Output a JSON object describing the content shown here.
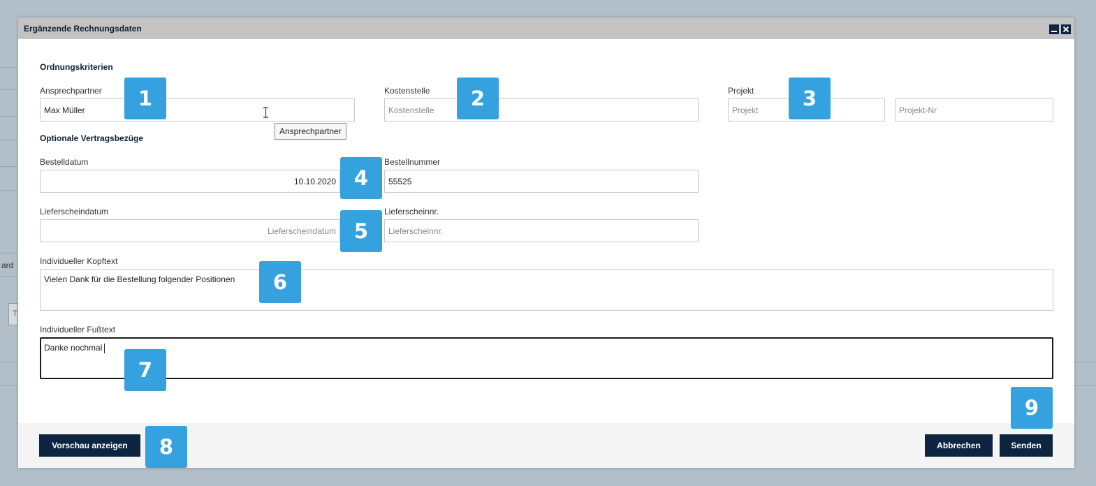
{
  "dialog": {
    "title": "Ergänzende Rechnungsdaten",
    "minimize_icon": "minimize-icon",
    "close_icon": "close-icon"
  },
  "background": {
    "fragment_text": "ard",
    "fragment_box_text": "T"
  },
  "ordering": {
    "heading": "Ordnungskriterien",
    "contact": {
      "label": "Ansprechpartner",
      "value": "Max Müller",
      "tooltip": "Ansprechpartner"
    },
    "cost_center": {
      "label": "Kostenstelle",
      "placeholder": "Kostenstelle"
    },
    "project": {
      "label": "Projekt",
      "placeholder": "Projekt",
      "number_placeholder": "Projekt-Nr"
    }
  },
  "contract": {
    "heading": "Optionale Vertragsbezüge",
    "order_date": {
      "label": "Bestelldatum",
      "value": "10.10.2020"
    },
    "order_number": {
      "label": "Bestellnummer",
      "value": "55525"
    },
    "delivery_date": {
      "label": "Lieferscheindatum",
      "placeholder": "Lieferscheindatum"
    },
    "delivery_number": {
      "label": "Lieferscheinnr.",
      "placeholder": "Lieferscheinnr."
    }
  },
  "texts": {
    "header": {
      "label": "Individueller Kopftext",
      "value": "Vielen Dank für die Bestellung folgender Positionen"
    },
    "footer": {
      "label": "Individueller Fußtext",
      "value": "Danke nochmal"
    }
  },
  "buttons": {
    "preview": "Vorschau anzeigen",
    "cancel": "Abbrechen",
    "send": "Senden"
  },
  "badges": [
    "1",
    "2",
    "3",
    "4",
    "5",
    "6",
    "7",
    "8",
    "9"
  ],
  "colors": {
    "accent": "#35a1de",
    "button": "#0d2540",
    "titlebar": "#c3c3c3"
  }
}
